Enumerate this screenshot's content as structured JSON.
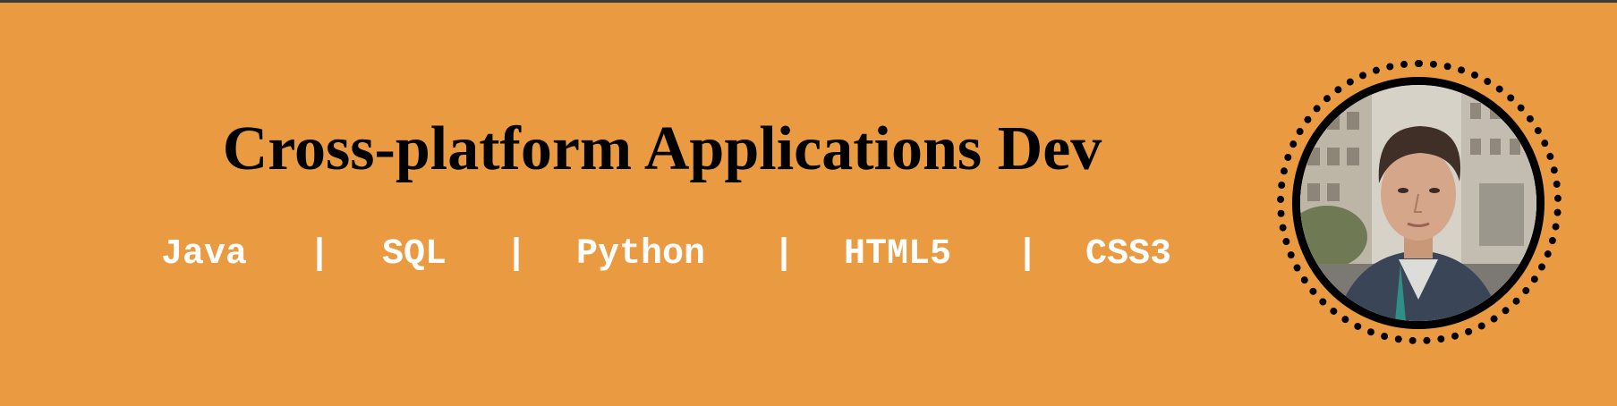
{
  "header": {
    "title": "Cross-platform Applications Dev",
    "skills": [
      "Java",
      "SQL",
      "Python",
      "HTML5",
      "CSS3"
    ],
    "separator": "|"
  },
  "profile": {
    "photo": "portrait-photo"
  }
}
